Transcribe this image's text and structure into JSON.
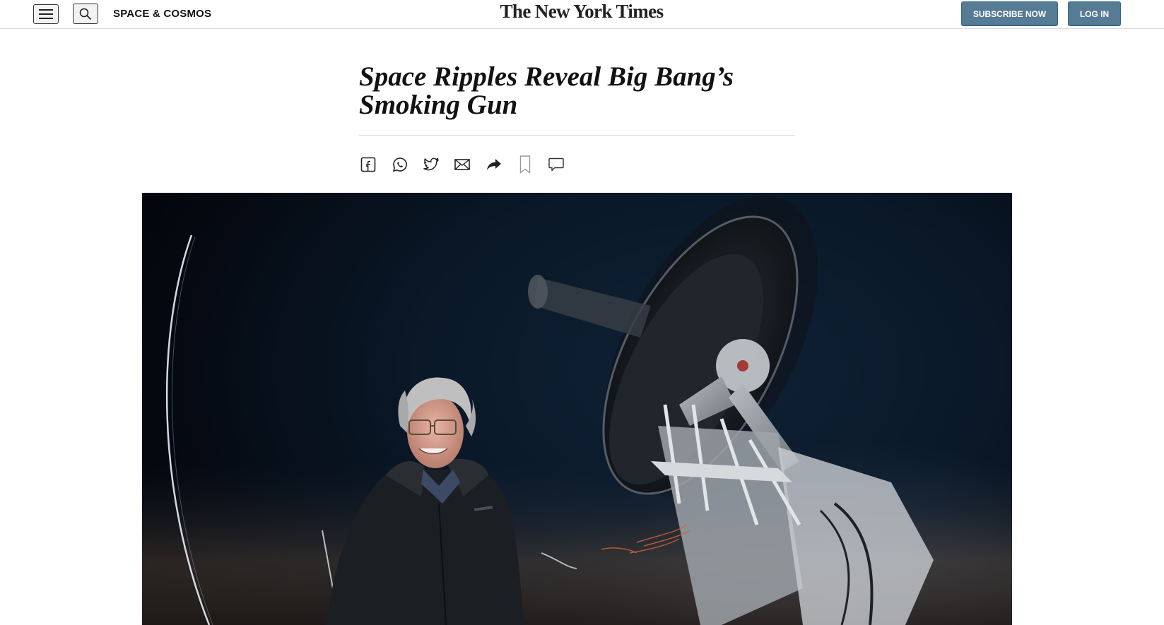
{
  "header": {
    "section_label": "SPACE & COSMOS",
    "logo_text": "The New York Times",
    "subscribe_label": "SUBSCRIBE NOW",
    "login_label": "LOG IN",
    "menu_icon": "hamburger-menu-icon",
    "search_icon": "search-icon"
  },
  "article": {
    "headline": "Space Ripples Reveal Big Bang’s Smoking Gun"
  },
  "share_bar": {
    "icons": [
      "facebook-icon",
      "whatsapp-icon",
      "twitter-icon",
      "email-icon",
      "share-icon",
      "bookmark-icon",
      "comment-icon"
    ]
  },
  "colors": {
    "accent": "#567b95",
    "text": "#121212",
    "rule": "#dcdcdc"
  }
}
